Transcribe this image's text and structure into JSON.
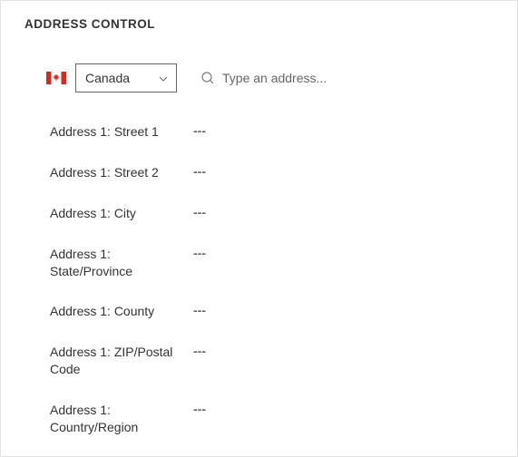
{
  "header": {
    "title": "ADDRESS CONTROL"
  },
  "country": {
    "selected": "Canada",
    "flag_name": "canada-flag"
  },
  "search": {
    "placeholder": "Type an address...",
    "value": ""
  },
  "fields": [
    {
      "label": "Address 1: Street 1",
      "value": "---"
    },
    {
      "label": "Address 1: Street 2",
      "value": "---"
    },
    {
      "label": "Address 1: City",
      "value": "---"
    },
    {
      "label": "Address 1: State/Province",
      "value": "---"
    },
    {
      "label": "Address 1: County",
      "value": "---"
    },
    {
      "label": "Address 1: ZIP/Postal Code",
      "value": "---"
    },
    {
      "label": "Address 1: Country/Region",
      "value": "---"
    }
  ]
}
